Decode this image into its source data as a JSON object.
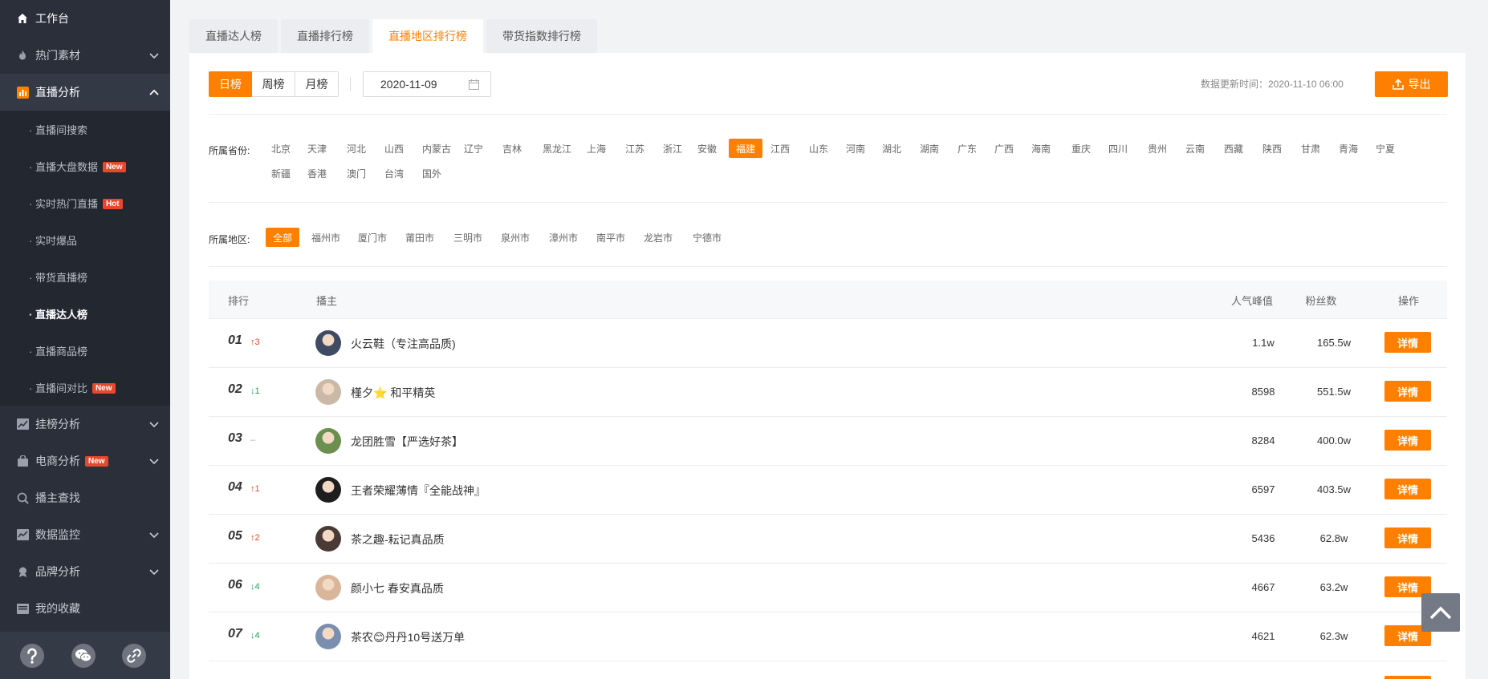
{
  "sidebar": {
    "workbench": "工作台",
    "groups": [
      {
        "label": "热门素材",
        "icon": "flame-icon"
      },
      {
        "label": "直播分析",
        "icon": "bar-chart-icon"
      }
    ],
    "sub_items": [
      {
        "label": "· 直播间搜索",
        "badge": ""
      },
      {
        "label": "· 直播大盘数据",
        "badge": "New"
      },
      {
        "label": "· 实时热门直播",
        "badge": "Hot"
      },
      {
        "label": "· 实时爆品",
        "badge": ""
      },
      {
        "label": "· 带货直播榜",
        "badge": ""
      },
      {
        "label": "· 直播达人榜",
        "badge": ""
      },
      {
        "label": "· 直播商品榜",
        "badge": ""
      },
      {
        "label": "· 直播间对比",
        "badge": "New"
      }
    ],
    "lower_groups": [
      {
        "label": "挂榜分析",
        "badge": ""
      },
      {
        "label": "电商分析",
        "badge": "New"
      },
      {
        "label": "播主查找",
        "badge": ""
      },
      {
        "label": "数据监控",
        "badge": ""
      },
      {
        "label": "品牌分析",
        "badge": ""
      },
      {
        "label": "我的收藏",
        "badge": ""
      }
    ]
  },
  "tabs": [
    "直播达人榜",
    "直播排行榜",
    "直播地区排行榜",
    "带货指数排行榜"
  ],
  "period": {
    "day": "日榜",
    "week": "周榜",
    "month": "月榜"
  },
  "date": "2020-11-09",
  "update_time": "数据更新时间：2020-11-10 06:00",
  "export_label": "导出",
  "province_label": "所属省份:",
  "provinces_row1": [
    "北京",
    "天津",
    "河北",
    "山西",
    "内蒙古",
    "辽宁",
    "吉林",
    "黑龙江",
    "上海",
    "江苏",
    "浙江",
    "安徽",
    "福建",
    "江西",
    "山东",
    "河南",
    "湖北",
    "湖南",
    "广东",
    "广西",
    "海南",
    "重庆",
    "四川",
    "贵州",
    "云南",
    "西藏",
    "陕西",
    "甘肃",
    "青海",
    "宁夏"
  ],
  "provinces_row2": [
    "新疆",
    "香港",
    "澳门",
    "台湾",
    "国外"
  ],
  "region_label": "所属地区:",
  "regions": [
    "全部",
    "福州市",
    "厦门市",
    "莆田市",
    "三明市",
    "泉州市",
    "漳州市",
    "南平市",
    "龙岩市",
    "宁德市"
  ],
  "table": {
    "headers": {
      "rank": "排行",
      "anchor": "播主",
      "peak": "人气峰值",
      "fans": "粉丝数",
      "op": "操作"
    },
    "detail_label": "详情",
    "rows": [
      {
        "rank": "01",
        "delta": "↑3",
        "dir": "up",
        "name": "火云鞋（专注高品质)",
        "peak": "1.1w",
        "fans": "165.5w"
      },
      {
        "rank": "02",
        "delta": "↓1",
        "dir": "down",
        "name": "槿夕⭐ 和平精英",
        "peak": "8598",
        "fans": "551.5w"
      },
      {
        "rank": "03",
        "delta": "–",
        "dir": "same",
        "name": "龙团胜雪【严选好茶】",
        "peak": "8284",
        "fans": "400.0w"
      },
      {
        "rank": "04",
        "delta": "↑1",
        "dir": "up",
        "name": "王者荣耀薄情『全能战神』",
        "peak": "6597",
        "fans": "403.5w"
      },
      {
        "rank": "05",
        "delta": "↑2",
        "dir": "up",
        "name": "茶之趣-耘记真品质",
        "peak": "5436",
        "fans": "62.8w"
      },
      {
        "rank": "06",
        "delta": "↓4",
        "dir": "down",
        "name": "颜小七 春安真品质",
        "peak": "4667",
        "fans": "63.2w"
      },
      {
        "rank": "07",
        "delta": "↓4",
        "dir": "down",
        "name": "茶农😊丹丹10号送万单",
        "peak": "4621",
        "fans": "62.3w"
      }
    ]
  }
}
